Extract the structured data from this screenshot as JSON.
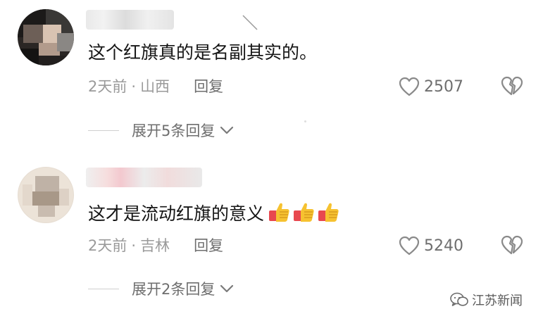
{
  "comments": [
    {
      "text": "这个红旗真的是名副其实的。",
      "time": "2天前",
      "separator": "·",
      "location": "山西",
      "reply_label": "回复",
      "likes": "2507",
      "expand_label": "展开5条回复"
    },
    {
      "text": "这才是流动红旗的意义",
      "emoji": [
        "thumbs-up-emoji",
        "thumbs-up-emoji",
        "thumbs-up-emoji"
      ],
      "time": "2天前",
      "separator": "·",
      "location": "吉林",
      "reply_label": "回复",
      "likes": "5240",
      "expand_label": "展开2条回复"
    }
  ],
  "watermark": {
    "text": "江苏新闻",
    "icon": "wechat-icon"
  },
  "icons": {
    "like": "heart-outline-icon",
    "dislike": "broken-heart-icon",
    "expand": "chevron-down-icon"
  },
  "colors": {
    "meta": "#9a9a9a",
    "action": "#6e6e6e",
    "text": "#151515"
  }
}
